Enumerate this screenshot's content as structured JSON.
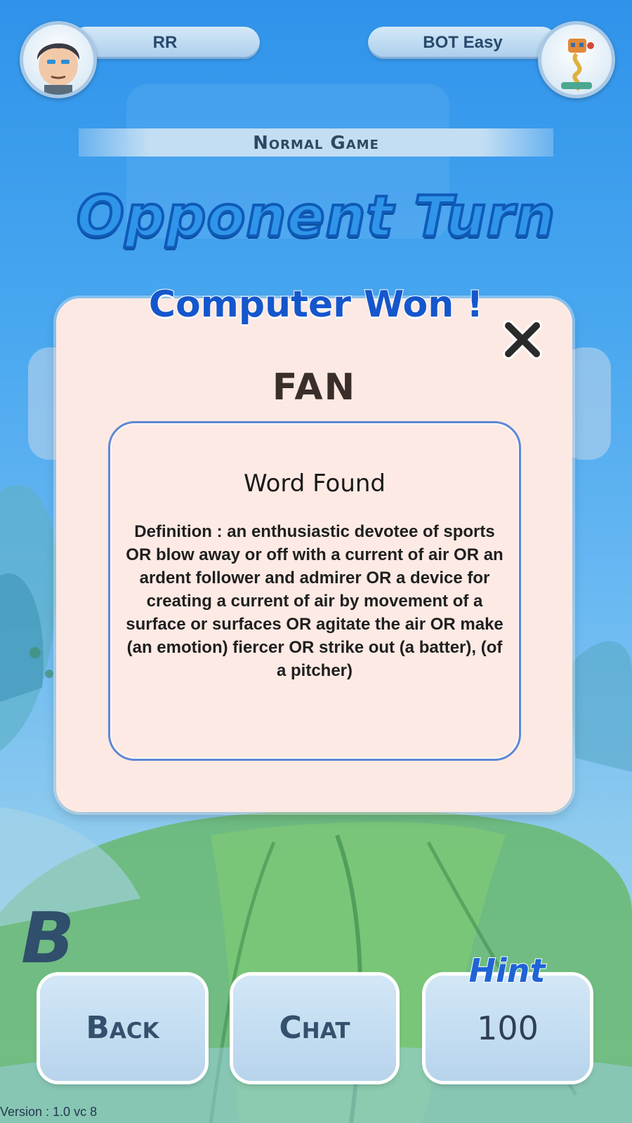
{
  "players": {
    "left": {
      "name": "RR",
      "avatar_icon": "boy-avatar-icon"
    },
    "right": {
      "name": "BOT Easy",
      "avatar_icon": "robot-avatar-icon"
    }
  },
  "mode_label": "Normal Game",
  "turn_label": "Opponent Turn",
  "result_modal": {
    "headline": "Computer Won !",
    "word": "FAN",
    "card_title": "Word Found",
    "definition": "Definition : an enthusiastic devotee of sports OR blow away or off with a current of air OR an ardent follower and admirer OR a device for creating a current of air by movement of a surface or surfaces OR agitate the air OR make (an emotion) fiercer OR strike out (a batter), (of a pitcher)",
    "close_icon": "close-icon"
  },
  "background_letter": "B",
  "buttons": {
    "back": "Back",
    "chat": "Chat",
    "hint_label": "Hint",
    "hint_cost": "100"
  },
  "version": "Version : 1.0 vc 8",
  "colors": {
    "title_blue": "#2f95e8",
    "headline_blue": "#1556cc",
    "modal_bg": "#fde9e3",
    "inner_border": "#5d88d6"
  }
}
